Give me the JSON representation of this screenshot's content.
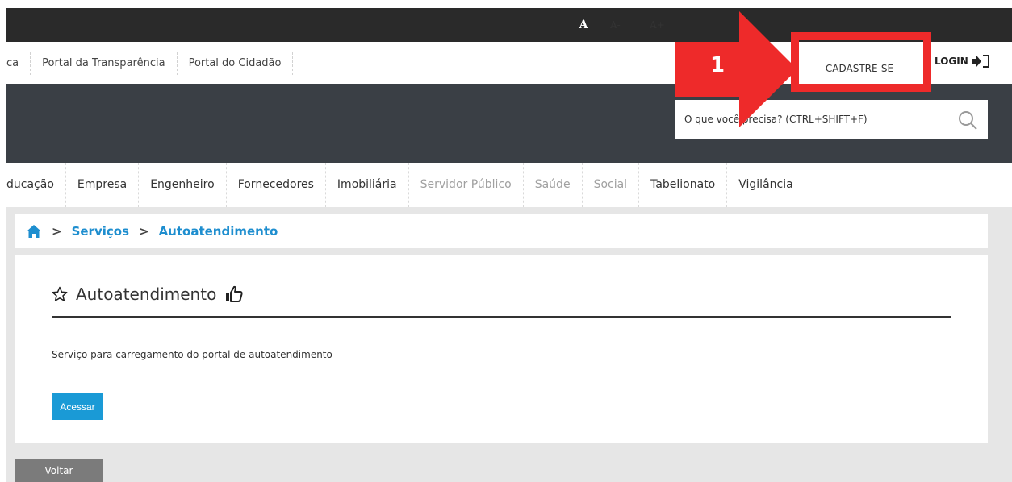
{
  "top_links": [
    "ca",
    "Portal da Transparência",
    "Portal do Cidadão"
  ],
  "font_controls": {
    "normal": "A",
    "decrease": "A-",
    "increase": "A+"
  },
  "account": {
    "register": "CADASTRE-SE",
    "login": "LOGIN"
  },
  "search": {
    "placeholder": "O que você precisa? (CTRL+SHIFT+F)"
  },
  "nav": [
    {
      "label": "ducação",
      "enabled": true
    },
    {
      "label": "Empresa",
      "enabled": true
    },
    {
      "label": "Engenheiro",
      "enabled": true
    },
    {
      "label": "Fornecedores",
      "enabled": true
    },
    {
      "label": "Imobiliária",
      "enabled": true
    },
    {
      "label": "Servidor Público",
      "enabled": false
    },
    {
      "label": "Saúde",
      "enabled": false
    },
    {
      "label": "Social",
      "enabled": false
    },
    {
      "label": "Tabelionato",
      "enabled": true
    },
    {
      "label": "Vigilância",
      "enabled": true
    }
  ],
  "breadcrumb": {
    "home_icon": "home-icon",
    "items": [
      "Serviços",
      "Autoatendimento"
    ],
    "separator": ">"
  },
  "card": {
    "title": "Autoatendimento",
    "description": "Serviço para carregamento do portal de autoatendimento",
    "action_label": "Acessar"
  },
  "back_label": "Voltar",
  "annotation": {
    "number": "1"
  },
  "colors": {
    "accent": "#1a9ad6",
    "link": "#1e8ecf",
    "annotation": "#ee2a2a",
    "header": "#3a3f45",
    "topbar": "#2a2a2a"
  }
}
